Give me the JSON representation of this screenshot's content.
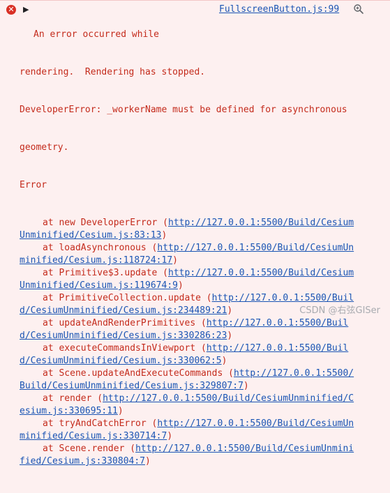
{
  "entry": {
    "error_glyph": "✕",
    "expand_glyph": "▶",
    "source": "FullscreenButton.js:99",
    "message_lines": [
      "An error occurred while",
      "rendering.  Rendering has stopped.",
      "DeveloperError: _workerName must be defined for asynchronous",
      "geometry.",
      "Error"
    ],
    "frames": [
      {
        "prefix": "at new DeveloperError (",
        "url1": "http://127.0.0.1:5500/Build/Cesium",
        "url2": "Unminified/Cesium.js:83:13",
        "suffix": ")"
      },
      {
        "prefix": "at loadAsynchronous (",
        "url1": "http://127.0.0.1:5500/Build/CesiumUn",
        "url2": "minified/Cesium.js:118724:17",
        "suffix": ")"
      },
      {
        "prefix": "at Primitive$3.update (",
        "url1": "http://127.0.0.1:5500/Build/Cesium",
        "url2": "Unminified/Cesium.js:119674:9",
        "suffix": ")"
      },
      {
        "prefix": "at PrimitiveCollection.update (",
        "url1": "http://127.0.0.1:5500/Buil",
        "url2": "d/CesiumUnminified/Cesium.js:234489:21",
        "suffix": ")"
      },
      {
        "prefix": "at updateAndRenderPrimitives (",
        "url1": "http://127.0.0.1:5500/Buil",
        "url2": "d/CesiumUnminified/Cesium.js:330286:23",
        "suffix": ")"
      },
      {
        "prefix": "at executeCommandsInViewport (",
        "url1": "http://127.0.0.1:5500/Buil",
        "url2": "d/CesiumUnminified/Cesium.js:330062:5",
        "suffix": ")"
      },
      {
        "prefix": "at Scene.updateAndExecuteCommands (",
        "url1": "http://127.0.0.1:5500/",
        "url2": "Build/CesiumUnminified/Cesium.js:329807:7",
        "suffix": ")"
      },
      {
        "prefix": "at render (",
        "url1": "http://127.0.0.1:5500/Build/CesiumUnminified/C",
        "url2": "esium.js:330695:11",
        "suffix": ")"
      },
      {
        "prefix": "at tryAndCatchError (",
        "url1": "http://127.0.0.1:5500/Build/CesiumUn",
        "url2": "minified/Cesium.js:330714:7",
        "suffix": ")"
      },
      {
        "prefix": "at Scene.render (",
        "url1": "http://127.0.0.1:5500/Build/CesiumUnmini",
        "url2": "fied/Cesium.js:330804:7",
        "suffix": ")"
      }
    ]
  },
  "icons": {
    "error": "error-circle-icon",
    "expand": "triangle-right-icon",
    "search": "search-icon"
  },
  "colors": {
    "background": "#fdf0f0",
    "error_text": "#c42b1c",
    "link": "#1a55b4"
  },
  "watermark": "CSDN @右弦GISer"
}
